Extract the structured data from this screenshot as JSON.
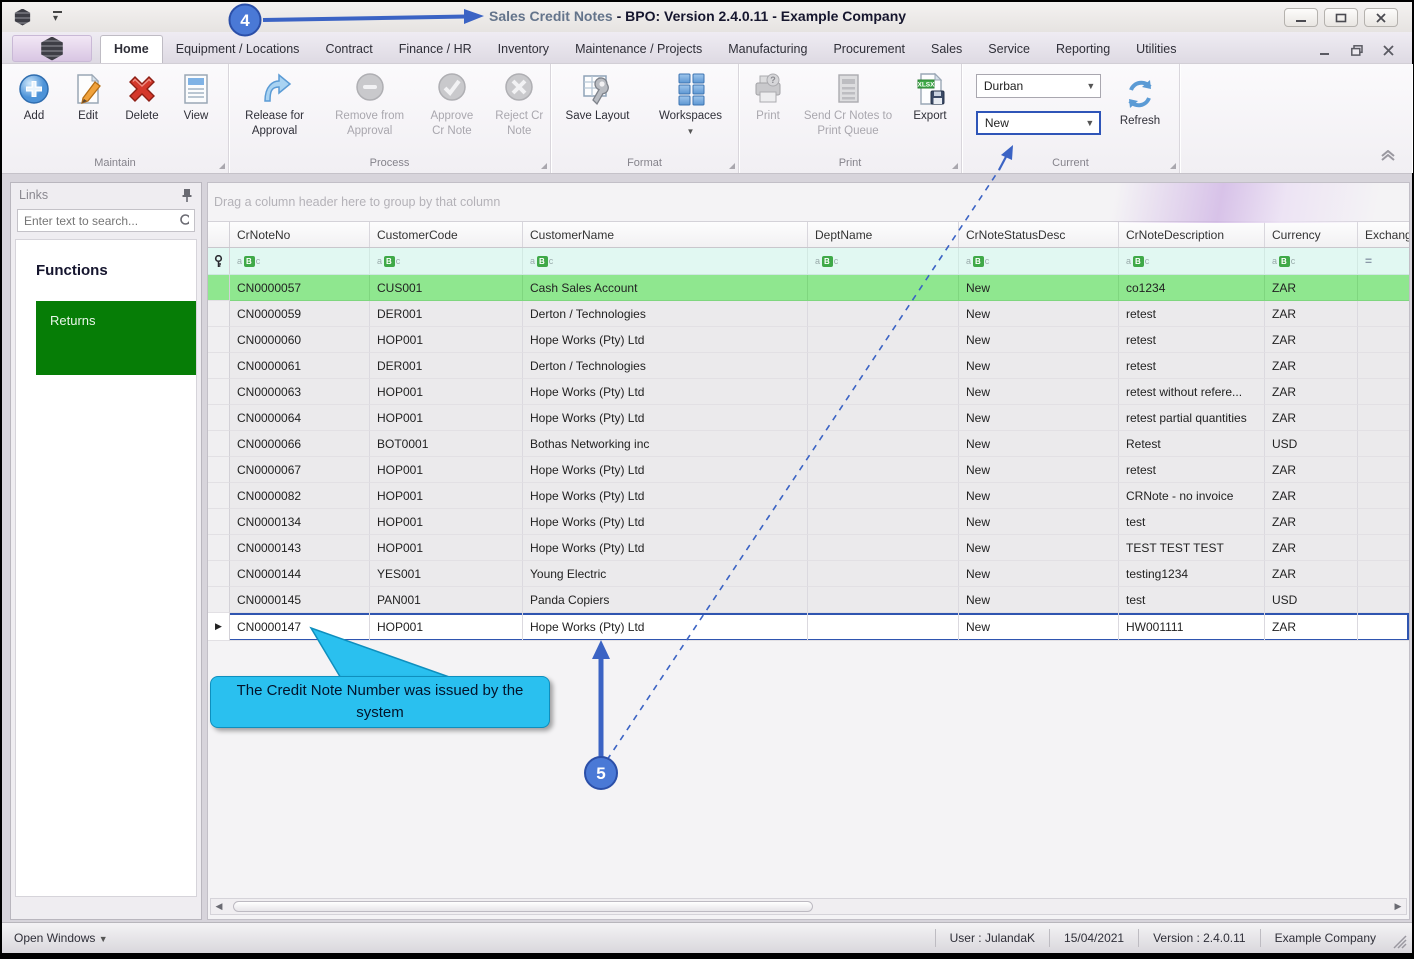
{
  "titlebar": {
    "title_light": "Sales Credit Notes",
    "title_bold": "- BPO: Version 2.4.0.11 - Example Company"
  },
  "menu_tabs": [
    "Home",
    "Equipment / Locations",
    "Contract",
    "Finance / HR",
    "Inventory",
    "Maintenance / Projects",
    "Manufacturing",
    "Procurement",
    "Sales",
    "Service",
    "Reporting",
    "Utilities"
  ],
  "ribbon": {
    "maintain": {
      "label": "Maintain",
      "add": "Add",
      "edit": "Edit",
      "delete": "Delete",
      "view": "View"
    },
    "process": {
      "label": "Process",
      "release": "Release for Approval",
      "remove": "Remove from Approval",
      "approve": "Approve Cr Note",
      "reject": "Reject Cr Note"
    },
    "format": {
      "label": "Format",
      "save_layout": "Save Layout",
      "workspaces": "Workspaces"
    },
    "print": {
      "label": "Print",
      "print": "Print",
      "send": "Send Cr Notes to Print Queue",
      "export": "Export"
    },
    "current": {
      "label": "Current",
      "site_value": "Durban",
      "status_value": "New",
      "refresh": "Refresh"
    }
  },
  "sidebar": {
    "title": "Links",
    "search_placeholder": "Enter text to search...",
    "functions_heading": "Functions",
    "items": [
      {
        "label": "Returns"
      }
    ]
  },
  "grid": {
    "group_by_hint": "Drag a column header here to group by that column",
    "columns": [
      "CrNoteNo",
      "CustomerCode",
      "CustomerName",
      "DeptName",
      "CrNoteStatusDesc",
      "CrNoteDescription",
      "Currency",
      "Exchang"
    ],
    "filter": {
      "text_icon": "aBc",
      "numeric_icon": "="
    },
    "selected_indicator": "▶",
    "rows": [
      [
        "CN0000057",
        "CUS001",
        "Cash Sales Account",
        "",
        "New",
        "co1234",
        "ZAR",
        ""
      ],
      [
        "CN0000059",
        "DER001",
        "Derton / Technologies",
        "",
        "New",
        "retest",
        "ZAR",
        ""
      ],
      [
        "CN0000060",
        "HOP001",
        "Hope Works (Pty) Ltd",
        "",
        "New",
        "retest",
        "ZAR",
        ""
      ],
      [
        "CN0000061",
        "DER001",
        "Derton / Technologies",
        "",
        "New",
        "retest",
        "ZAR",
        ""
      ],
      [
        "CN0000063",
        "HOP001",
        "Hope Works (Pty) Ltd",
        "",
        "New",
        "retest without refere...",
        "ZAR",
        ""
      ],
      [
        "CN0000064",
        "HOP001",
        "Hope Works (Pty) Ltd",
        "",
        "New",
        "retest partial quantities",
        "ZAR",
        ""
      ],
      [
        "CN0000066",
        "BOT0001",
        "Bothas Networking inc",
        "",
        "New",
        "Retest",
        "USD",
        ""
      ],
      [
        "CN0000067",
        "HOP001",
        "Hope Works (Pty) Ltd",
        "",
        "New",
        "retest",
        "ZAR",
        ""
      ],
      [
        "CN0000082",
        "HOP001",
        "Hope Works (Pty) Ltd",
        "",
        "New",
        "CRNote - no invoice",
        "ZAR",
        ""
      ],
      [
        "CN0000134",
        "HOP001",
        "Hope Works (Pty) Ltd",
        "",
        "New",
        "test",
        "ZAR",
        ""
      ],
      [
        "CN0000143",
        "HOP001",
        "Hope Works (Pty) Ltd",
        "",
        "New",
        "TEST TEST TEST",
        "ZAR",
        ""
      ],
      [
        "CN0000144",
        "YES001",
        "Young Electric",
        "",
        "New",
        "testing1234",
        "ZAR",
        ""
      ],
      [
        "CN0000145",
        "PAN001",
        "Panda Copiers",
        "",
        "New",
        "test",
        "USD",
        ""
      ],
      [
        "CN0000147",
        "HOP001",
        "Hope Works (Pty) Ltd",
        "",
        "New",
        "HW001111",
        "ZAR",
        ""
      ]
    ],
    "green_row_index": 0,
    "selected_row_index": 13
  },
  "statusbar": {
    "open_windows": "Open Windows",
    "user": "User : JulandaK",
    "date": "15/04/2021",
    "version": "Version : 2.4.0.11",
    "company": "Example Company"
  },
  "annotations": {
    "step4": "4",
    "step5": "5",
    "callout": "The Credit Note Number was issued by the system"
  },
  "colors": {
    "annotation_blue": "#3B63C4",
    "callout_cyan": "#2AC0EF",
    "green_row": "#8FE78F",
    "returns_green": "#067D06",
    "selection_border": "#2F55B0",
    "filter_row_bg": "#E1F8F2"
  }
}
